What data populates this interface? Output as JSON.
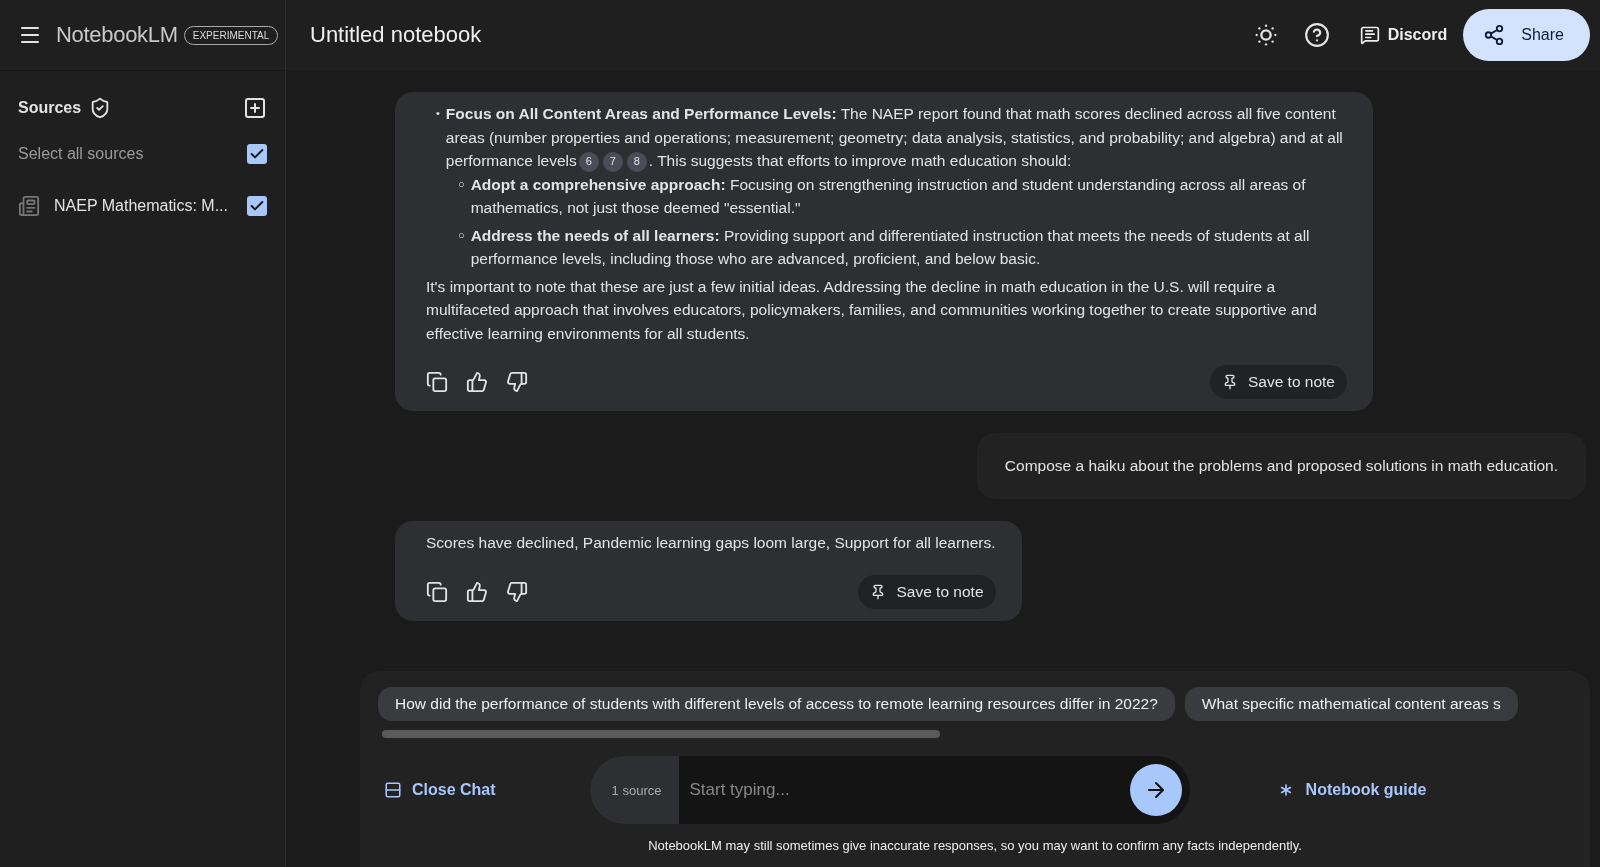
{
  "header": {
    "app_name": "NotebookLM",
    "badge": "EXPERIMENTAL",
    "notebook_title": "Untitled notebook",
    "discord": "Discord",
    "share": "Share"
  },
  "sidebar": {
    "title": "Sources",
    "select_all": {
      "label": "Select all sources",
      "checked": true
    },
    "sources": [
      {
        "title": "NAEP Mathematics: M...",
        "checked": true
      }
    ]
  },
  "messages": [
    {
      "kind": "response",
      "blocks": [
        {
          "kind": "bullet",
          "marker": "•",
          "before": "**Focus on All Content Areas and Performance Levels:** The NAEP report found that math scores declined across all five content areas (number properties and operations; measurement; geometry; data analysis, statistics, and probability; and algebra) and at all performance levels",
          "citations": [
            "6",
            "7",
            "8"
          ],
          "after": ". This suggests that efforts to improve math education should:"
        },
        {
          "kind": "subbullet",
          "marker": "○",
          "before": "**Adopt a comprehensive approach:** Focusing on strengthening instruction and student understanding across all areas of mathematics, not just those deemed \"essential.\""
        },
        {
          "kind": "subbullet",
          "marker": "○",
          "before": "**Address the needs of all learners:** Providing support and differentiated instruction that meets the needs of students at all performance levels, including those who are advanced, proficient, and below basic."
        },
        {
          "kind": "paragraph",
          "before": "It's important to note that these are just a few initial ideas. Addressing the decline in math education in the U.S. will require a multifaceted approach that involves educators, policymakers, families, and communities working together to create supportive and effective learning environments for all students."
        }
      ],
      "save": "Save to note"
    },
    {
      "kind": "query",
      "text": "Compose a haiku about the problems and proposed solutions in math education."
    },
    {
      "kind": "response",
      "blocks": [
        {
          "kind": "paragraph",
          "before": "Scores have declined, Pandemic learning gaps loom large, Support for all learners."
        }
      ],
      "save": "Save to note"
    }
  ],
  "suggestions": [
    "How did the performance of students with different levels of access to remote learning resources differ in 2022?",
    "What specific mathematical content areas s"
  ],
  "composer": {
    "close_chat": "Close Chat",
    "source_count": "1 source",
    "placeholder": "Start typing...",
    "notebook_guide": "Notebook guide"
  },
  "disclaimer": "NotebookLM may still sometimes give inaccurate responses, so you may want to confirm any facts independently."
}
